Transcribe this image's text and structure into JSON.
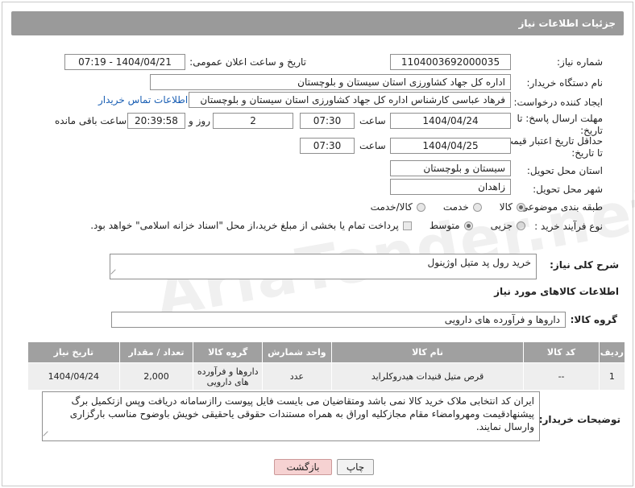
{
  "header": {
    "title": "جزئیات اطلاعات نیاز"
  },
  "form": {
    "need_number_label": "شماره نیاز:",
    "need_number": "1104003692000035",
    "announce_label": "تاریخ و ساعت اعلان عمومی:",
    "announce_value": "1404/04/21 - 07:19",
    "buyer_label": "نام دستگاه خریدار:",
    "buyer_value": "اداره کل جهاد کشاورزی استان سیستان و بلوچستان",
    "creator_label": "ایجاد کننده درخواست:",
    "creator_value": "فرهاد عباسی کارشناس  اداره کل جهاد کشاورزی استان سیستان و بلوچستان",
    "contact_link": "اطلاعات تماس خریدار",
    "reply_deadline_label": "مهلت ارسال پاسخ: تا تاریخ:",
    "reply_date": "1404/04/24",
    "time_label": "ساعت",
    "reply_time": "07:30",
    "days_value": "2",
    "days_label": "روز و",
    "remaining_time": "20:39:58",
    "remaining_label": "ساعت باقی مانده",
    "price_deadline_label": "حداقل تاریخ اعتبار قیمت: تا تاریخ:",
    "price_date": "1404/04/25",
    "price_time": "07:30",
    "province_label": "استان محل تحویل:",
    "province_value": "سیستان و بلوچستان",
    "city_label": "شهر محل تحویل:",
    "city_value": "زاهدان",
    "category_label": "طبقه بندی موضوعی:",
    "category_options": [
      "کالا",
      "خدمت",
      "کالا/خدمت"
    ],
    "process_label": "نوع فرآیند خرید :",
    "process_options": [
      "جزیی",
      "متوسط"
    ],
    "payment_note": "پرداخت تمام یا بخشی از مبلغ خرید،از محل \"اسناد خزانه اسلامی\" خواهد بود."
  },
  "description": {
    "label": "شرح کلی نیاز:",
    "value": "خرید رول پد متیل اوژینول"
  },
  "goods": {
    "section_title": "اطلاعات کالاهای مورد نیاز",
    "group_label": "گروه کالا:",
    "group_value": "داروها و فرآورده های دارویی",
    "columns": [
      "ردیف",
      "کد کالا",
      "نام کالا",
      "واحد شمارش",
      "گروه کالا",
      "تعداد / مقدار",
      "تاریخ نیاز"
    ],
    "rows": [
      {
        "row": "1",
        "code": "--",
        "name": "قرص متیل قنیدات هیدروکلراید",
        "unit": "عدد",
        "group": "داروها و فرآورده های دارویی",
        "qty": "2,000",
        "date": "1404/04/24"
      }
    ]
  },
  "buyer_notes": {
    "label": "توضیحات خریدار:",
    "value": "ایران کد انتخابی ملاک خرید کالا نمی باشد ومتقاضیان می بایست فایل پیوست رااز‌سامانه دریافت وپس ازتکمیل برگ پیشنهادقیمت ومهروامضاء مقام مجازکلیه اوراق به همراه مستندات حقوقی یاحقیقی خویش باوضوح مناسب بارگزاری وارسال نمایند."
  },
  "buttons": {
    "print": "چاپ",
    "back": "بازگشت"
  }
}
